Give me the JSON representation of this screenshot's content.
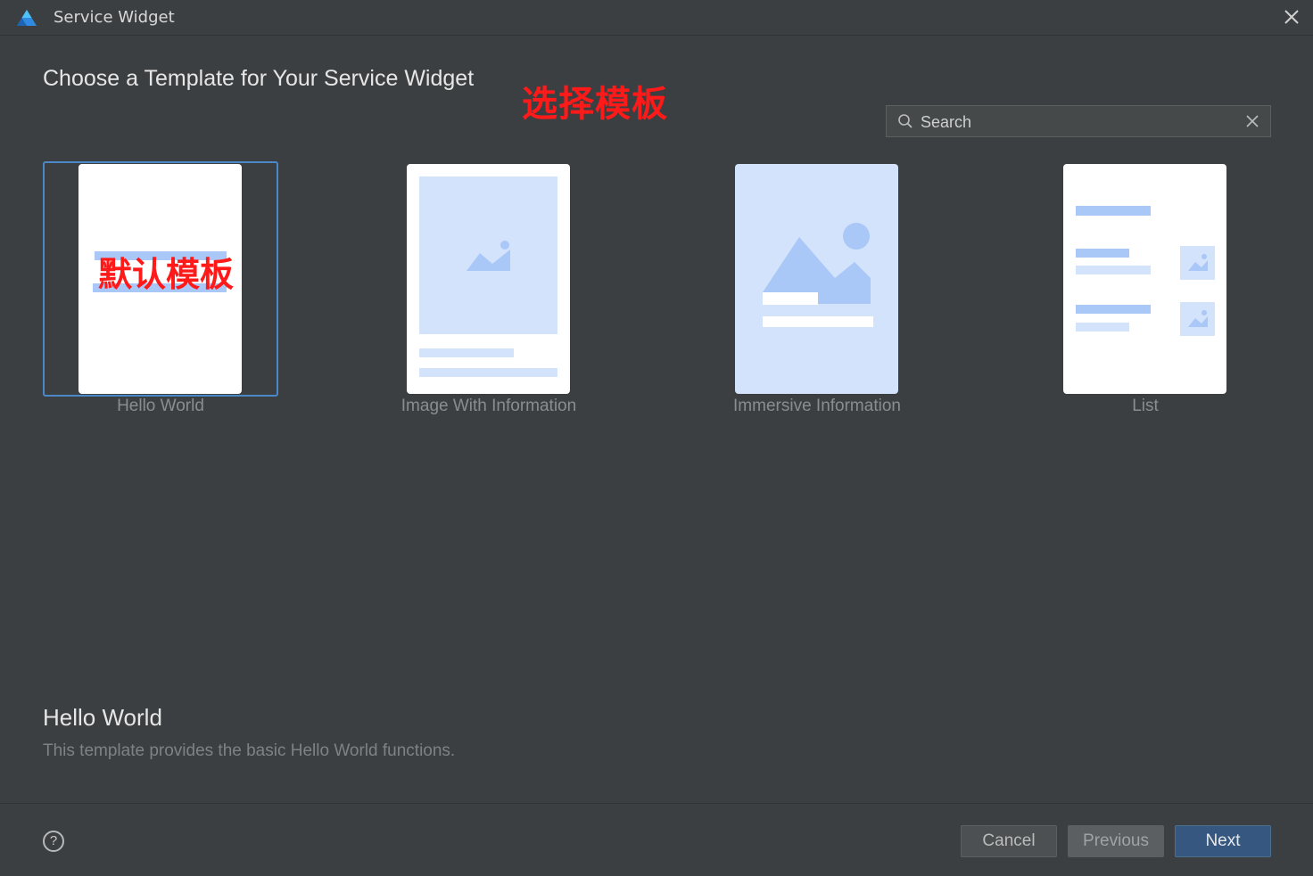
{
  "window": {
    "title": "Service Widget"
  },
  "page": {
    "heading": "Choose a Template for Your Service Widget",
    "annotation_top": "选择模板"
  },
  "search": {
    "placeholder": "Search"
  },
  "templates": [
    {
      "label": "Hello World",
      "selected": true,
      "annotation": "默认模板"
    },
    {
      "label": "Image With Information",
      "selected": false
    },
    {
      "label": "Immersive Information",
      "selected": false
    },
    {
      "label": "List",
      "selected": false
    }
  ],
  "description": {
    "title": "Hello World",
    "text": "This template provides the basic Hello World functions."
  },
  "footer": {
    "help": "?",
    "cancel": "Cancel",
    "previous": "Previous",
    "next": "Next"
  },
  "colors": {
    "background": "#3c3f41",
    "selection": "#4a88c7",
    "primary_button": "#365880",
    "annotation": "#ff1a1a",
    "placeholder_blue": "#d4e3fc",
    "graphic_blue": "#a9c7f7"
  }
}
